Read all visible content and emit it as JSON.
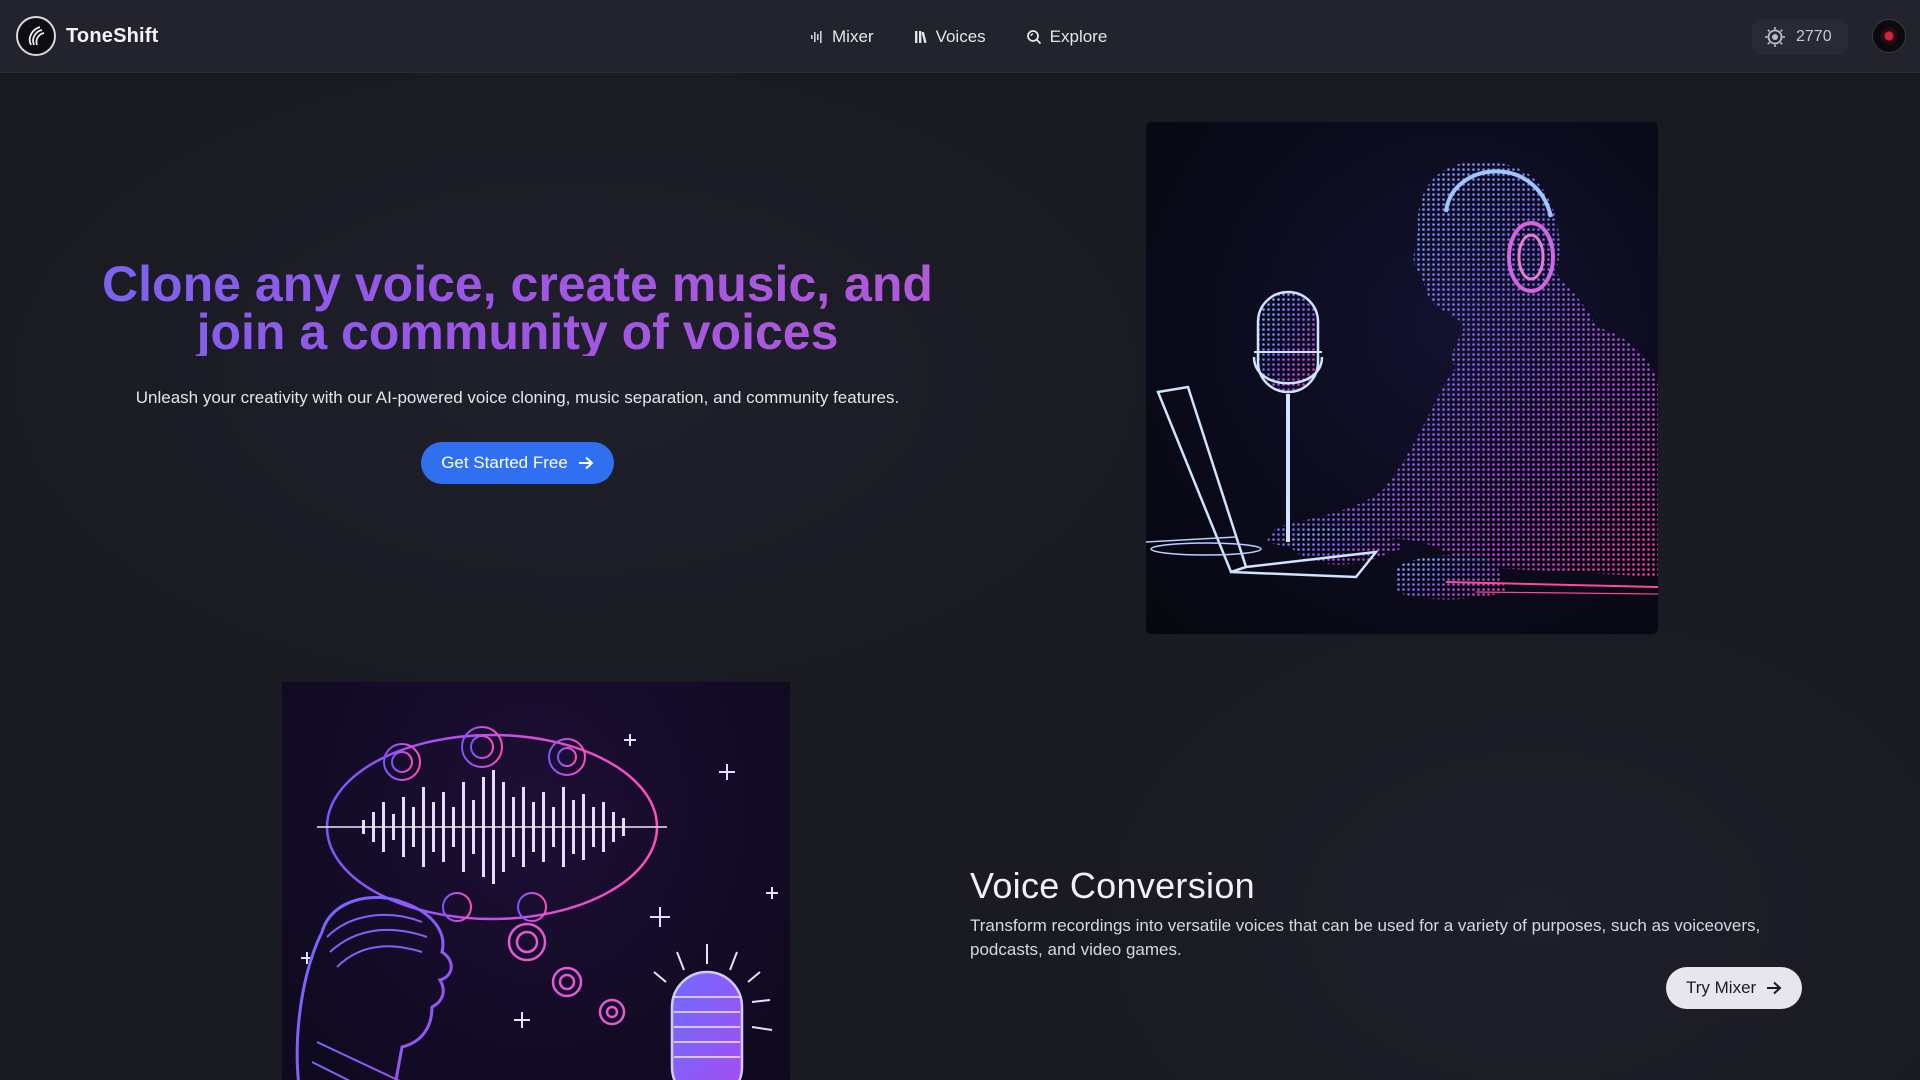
{
  "nav": {
    "brand": "ToneShift",
    "links": [
      {
        "label": "Mixer",
        "icon": "waveform-icon"
      },
      {
        "label": "Voices",
        "icon": "library-icon"
      },
      {
        "label": "Explore",
        "icon": "explore-icon"
      }
    ],
    "credits": "2770"
  },
  "hero": {
    "title_line1": "Clone any voice, create music, and",
    "title_line2": "join a community of voices",
    "subtitle": "Unleash your creativity with our AI-powered voice cloning, music separation, and community features.",
    "cta_label": "Get Started Free"
  },
  "feature": {
    "title": "Voice Conversion",
    "description": "Transform recordings into versatile voices that can be used for a variety of purposes, such as voiceovers, podcasts, and video games.",
    "cta_label": "Try Mixer"
  },
  "colors": {
    "accent": "#2f6ff0",
    "title_gradient_start": "#7a63f0",
    "title_gradient_end": "#b35ad8",
    "background": "#1c1c24"
  }
}
